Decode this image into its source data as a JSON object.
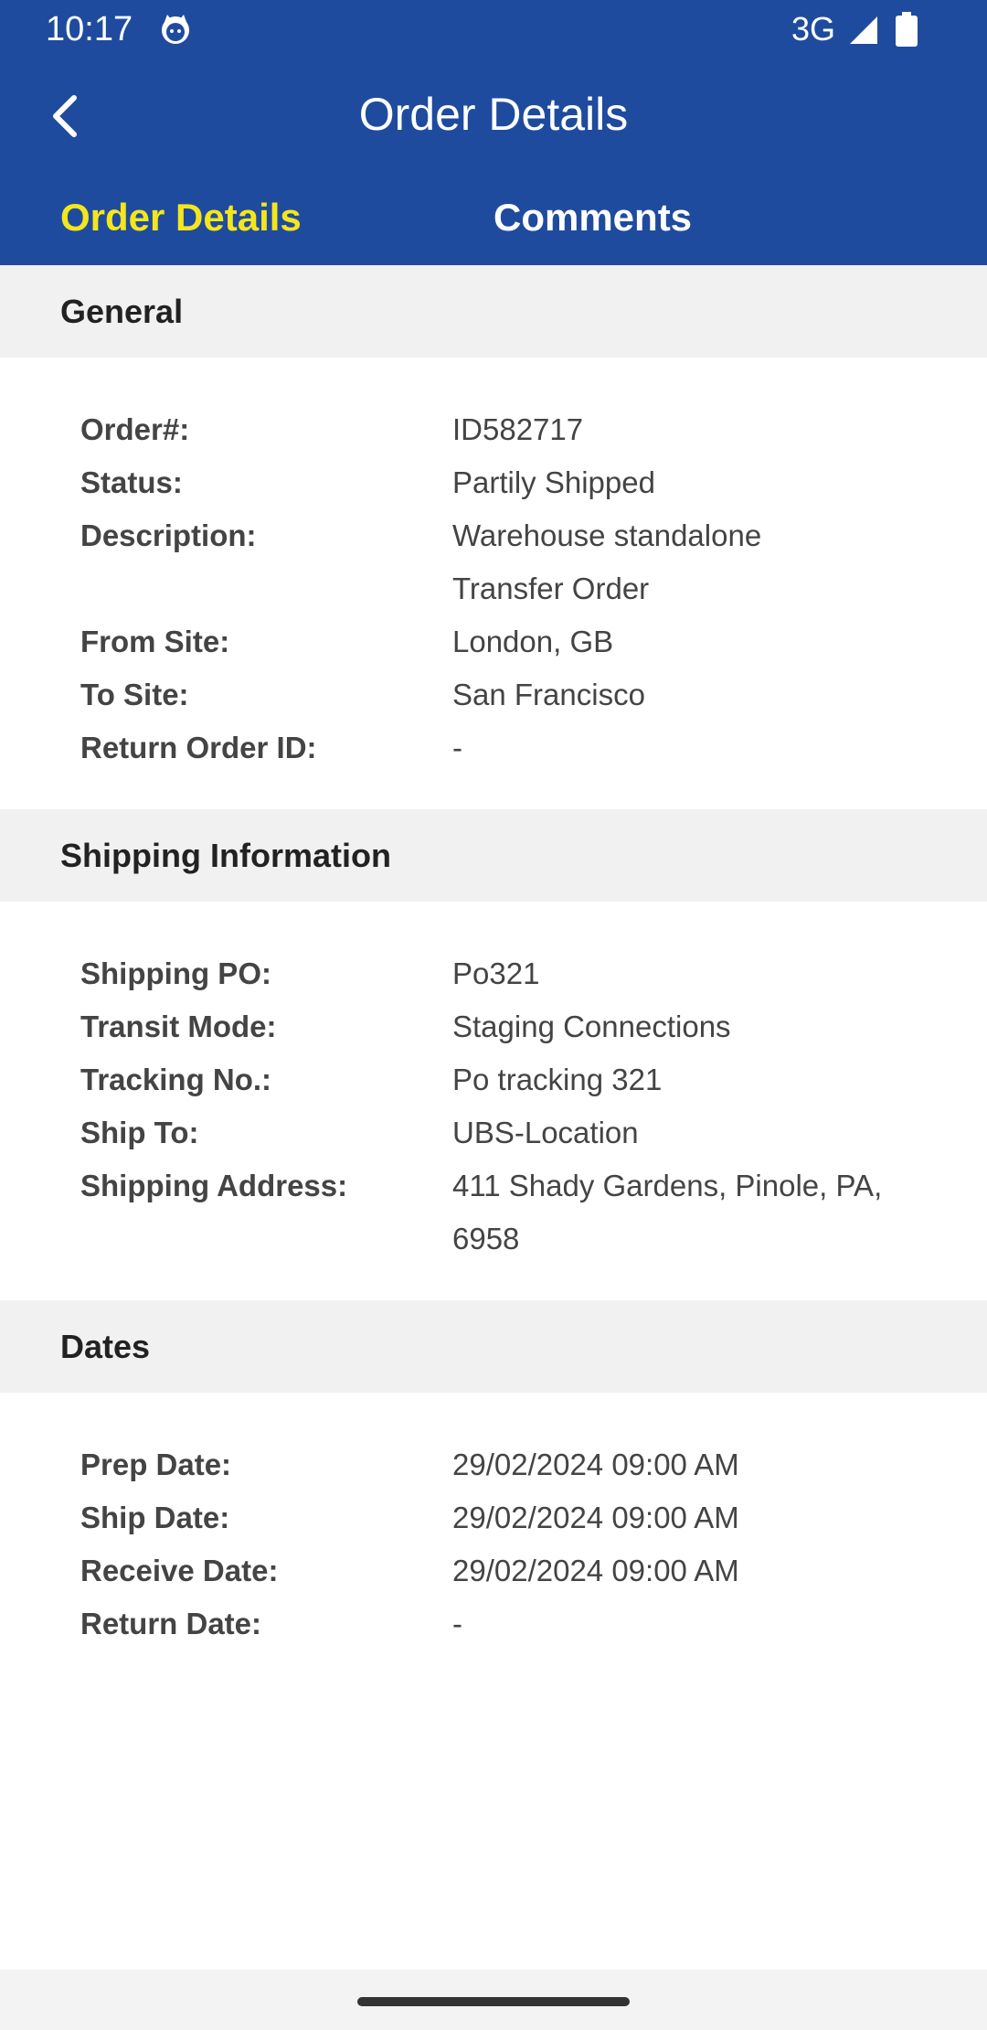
{
  "status_bar": {
    "time": "10:17",
    "network": "3G",
    "icons": [
      "notification-cat-icon",
      "signal-icon",
      "battery-icon"
    ]
  },
  "app_bar": {
    "title": "Order Details",
    "back_icon": "back-arrow-icon"
  },
  "tabs": [
    {
      "label": "Order Details",
      "active": true
    },
    {
      "label": "Comments",
      "active": false
    }
  ],
  "sections": {
    "general": {
      "title": "General",
      "rows": [
        {
          "label": "Order#:",
          "value": "ID582717"
        },
        {
          "label": "Status:",
          "value": "Partily Shipped"
        },
        {
          "label": "Description:",
          "value": "Warehouse standalone Transfer Order"
        },
        {
          "label": "From Site:",
          "value": "London, GB"
        },
        {
          "label": "To Site:",
          "value": "San Francisco"
        },
        {
          "label": "Return Order ID:",
          "value": "-"
        }
      ]
    },
    "shipping": {
      "title": "Shipping Information",
      "rows": [
        {
          "label": "Shipping PO:",
          "value": "Po321"
        },
        {
          "label": "Transit Mode:",
          "value": "Staging Connections"
        },
        {
          "label": "Tracking No.:",
          "value": "Po tracking 321"
        },
        {
          "label": "Ship To:",
          "value": "UBS-Location"
        },
        {
          "label": "Shipping Address:",
          "value": "411 Shady Gardens, Pinole, PA, 6958"
        }
      ]
    },
    "dates": {
      "title": "Dates",
      "rows": [
        {
          "label": "Prep Date:",
          "value": "29/02/2024 09:00 AM"
        },
        {
          "label": "Ship Date:",
          "value": "29/02/2024 09:00 AM"
        },
        {
          "label": "Receive Date:",
          "value": "29/02/2024 09:00 AM"
        },
        {
          "label": "Return Date:",
          "value": "-"
        }
      ]
    }
  },
  "colors": {
    "header_bg": "#1f4b9f",
    "active_tab": "#f5e61b",
    "section_bg": "#f1f1f1"
  }
}
